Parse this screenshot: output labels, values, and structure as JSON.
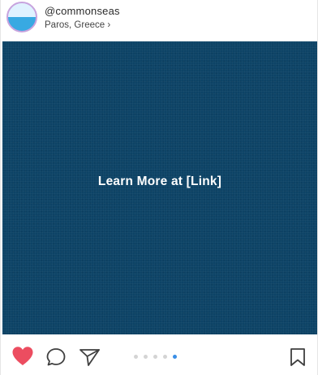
{
  "header": {
    "username": "@commonseas",
    "location": "Paros, Greece ›"
  },
  "post": {
    "image_text": "Learn More at [Link]"
  },
  "carousel": {
    "total": 5,
    "active_index": 4
  },
  "icons": {
    "like": "heart-icon",
    "comment": "comment-icon",
    "share": "paper-plane-icon",
    "save": "bookmark-icon"
  },
  "colors": {
    "image_background": "#0d4366",
    "like_active": "#ec4d60",
    "carousel_active": "#3a8ee6"
  }
}
